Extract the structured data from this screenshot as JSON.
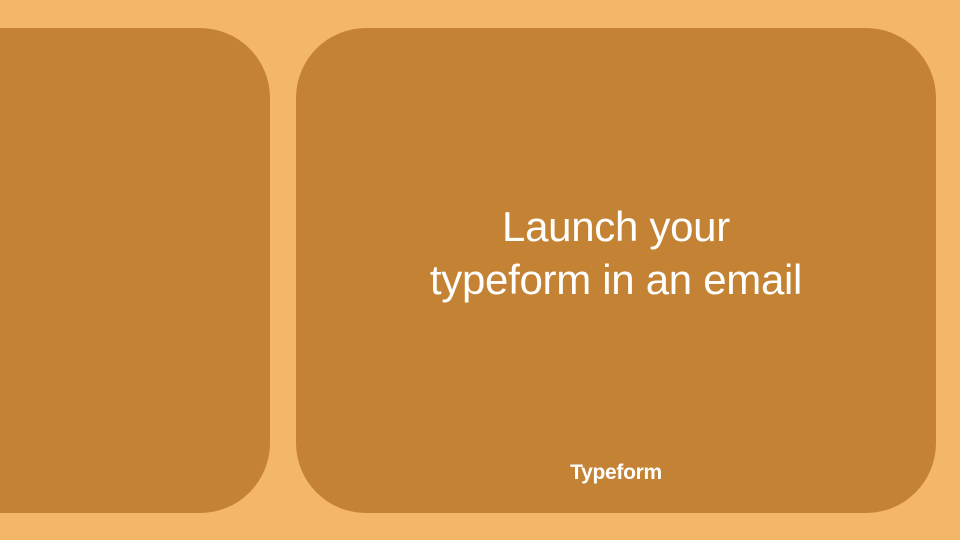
{
  "colors": {
    "background": "#f4b668",
    "panel": "#c48334",
    "text": "#ffffff"
  },
  "headline_line1": "Launch your",
  "headline_line2": "typeform in an email",
  "brand": "Typeform"
}
